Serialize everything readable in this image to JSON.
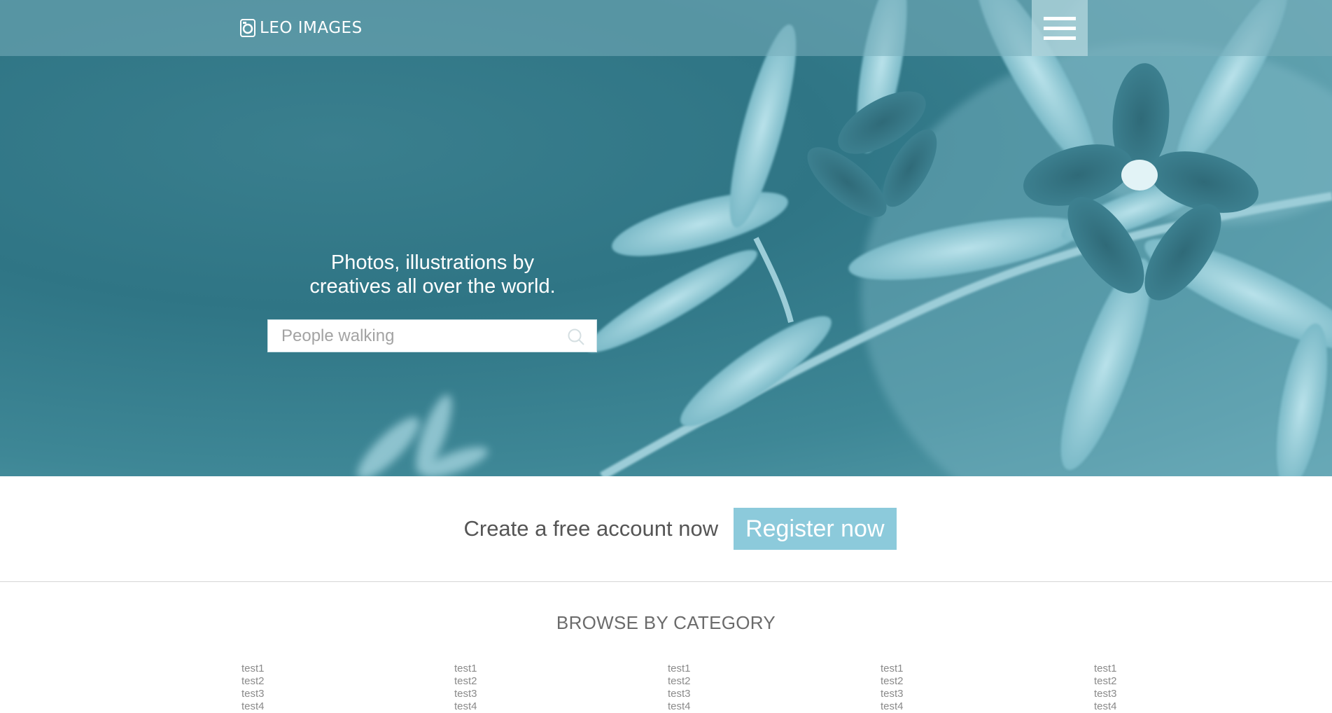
{
  "brand": {
    "name": "LEO IMAGES"
  },
  "hero": {
    "tagline_line1": "Photos, illustrations by",
    "tagline_line2": "creatives all over the world.",
    "search_placeholder": "People walking"
  },
  "register": {
    "text": "Create a free account now",
    "button_label": "Register now"
  },
  "categories": {
    "title": "BROWSE BY CATEGORY",
    "columns": [
      [
        "test1",
        "test2",
        "test3",
        "test4"
      ],
      [
        "test1",
        "test2",
        "test3",
        "test4"
      ],
      [
        "test1",
        "test2",
        "test3",
        "test4"
      ],
      [
        "test1",
        "test2",
        "test3",
        "test4"
      ],
      [
        "test1",
        "test2",
        "test3",
        "test4"
      ]
    ]
  },
  "colors": {
    "hero_tint": "#3a7f8e",
    "accent_button": "#8ccadb",
    "text_muted": "#8a8a8a"
  },
  "icons": {
    "logo": "camera-icon",
    "menu": "hamburger-icon",
    "search": "search-icon"
  }
}
